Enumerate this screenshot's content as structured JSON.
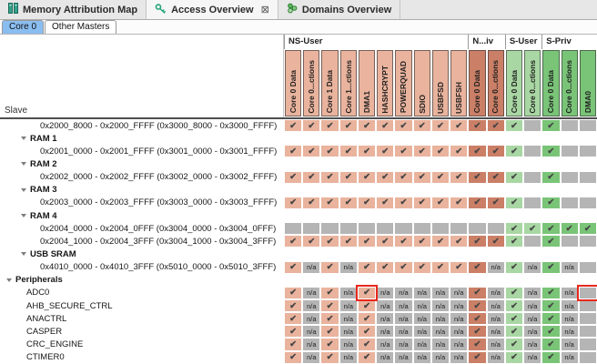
{
  "colors": {
    "ns": "#e9b39d",
    "nspriv": "#ca7f66",
    "suser": "#a9d7a3",
    "spriv": "#7ac478",
    "empty": "#b5b5b5",
    "highlight": "#e8281e",
    "subtab_selected": "#8abdf0",
    "check": "#454545"
  },
  "view_tabs": [
    {
      "label": "Memory Attribution Map",
      "icon": "memory-map-icon",
      "active": false
    },
    {
      "label": "Access Overview",
      "icon": "key-icon",
      "active": true,
      "close_glyph": "⊠"
    },
    {
      "label": "Domains Overview",
      "icon": "domains-icon",
      "active": false
    }
  ],
  "sub_tabs": [
    {
      "label": "Core 0",
      "active": true
    },
    {
      "label": "Other Masters",
      "active": false
    }
  ],
  "table": {
    "slave_header": "Slave",
    "check_glyph": "✔",
    "na_label": "n/a",
    "groups": [
      {
        "label": "NS-User",
        "span": 10
      },
      {
        "label": "N...iv",
        "span": 2
      },
      {
        "label": "S-User",
        "span": 2
      },
      {
        "label": "S-Priv",
        "span": 3
      }
    ],
    "columns": [
      {
        "label": "Core 0 Data",
        "color": "ns"
      },
      {
        "label": "Core 0...ctions",
        "color": "ns"
      },
      {
        "label": "Core 1 Data",
        "color": "ns"
      },
      {
        "label": "Core 1...ctions",
        "color": "ns"
      },
      {
        "label": "DMA1",
        "color": "ns"
      },
      {
        "label": "HASHCRYPT",
        "color": "ns"
      },
      {
        "label": "POWERQUAD",
        "color": "ns"
      },
      {
        "label": "SDIO",
        "color": "ns"
      },
      {
        "label": "USBFSD",
        "color": "ns"
      },
      {
        "label": "USBFSH",
        "color": "ns"
      },
      {
        "label": "Core 0 Data",
        "color": "nspriv"
      },
      {
        "label": "Core 0...ctions",
        "color": "nspriv"
      },
      {
        "label": "Core 0 Data",
        "color": "suser"
      },
      {
        "label": "Core 0...ctions",
        "color": "suser"
      },
      {
        "label": "Core 0 Data",
        "color": "spriv"
      },
      {
        "label": "Core 0...ctions",
        "color": "spriv"
      },
      {
        "label": "DMA0",
        "color": "spriv"
      }
    ],
    "rows": [
      {
        "type": "addr",
        "label": "0x2000_8000 - 0x2000_FFFF (0x3000_8000 - 0x3000_FFFF)",
        "cells": [
          "ck",
          "ck",
          "ck",
          "ck",
          "ck",
          "ck",
          "ck",
          "ck",
          "ck",
          "ck",
          "ck",
          "ck",
          "ck",
          "",
          "ck",
          "",
          ""
        ]
      },
      {
        "type": "group",
        "indent": 1,
        "label": "RAM 1"
      },
      {
        "type": "addr",
        "label": "0x2001_0000 - 0x2001_FFFF (0x3001_0000 - 0x3001_FFFF)",
        "cells": [
          "ck",
          "ck",
          "ck",
          "ck",
          "ck",
          "ck",
          "ck",
          "ck",
          "ck",
          "ck",
          "ck",
          "ck",
          "ck",
          "",
          "ck",
          "",
          ""
        ]
      },
      {
        "type": "group",
        "indent": 1,
        "label": "RAM 2"
      },
      {
        "type": "addr",
        "label": "0x2002_0000 - 0x2002_FFFF (0x3002_0000 - 0x3002_FFFF)",
        "cells": [
          "ck",
          "ck",
          "ck",
          "ck",
          "ck",
          "ck",
          "ck",
          "ck",
          "ck",
          "ck",
          "ck",
          "ck",
          "ck",
          "",
          "ck",
          "",
          ""
        ]
      },
      {
        "type": "group",
        "indent": 1,
        "label": "RAM 3"
      },
      {
        "type": "addr",
        "label": "0x2003_0000 - 0x2003_FFFF (0x3003_0000 - 0x3003_FFFF)",
        "cells": [
          "ck",
          "ck",
          "ck",
          "ck",
          "ck",
          "ck",
          "ck",
          "ck",
          "ck",
          "ck",
          "ck",
          "ck",
          "ck",
          "",
          "ck",
          "",
          ""
        ]
      },
      {
        "type": "group",
        "indent": 1,
        "label": "RAM 4"
      },
      {
        "type": "addr",
        "label": "0x2004_0000 - 0x2004_0FFF (0x3004_0000 - 0x3004_0FFF)",
        "cells": [
          "",
          "",
          "",
          "",
          "",
          "",
          "",
          "",
          "",
          "",
          "",
          "",
          "ck",
          "ck",
          "ck",
          "ck",
          "ck"
        ]
      },
      {
        "type": "addr",
        "label": "0x2004_1000 - 0x2004_3FFF (0x3004_1000 - 0x3004_3FFF)",
        "cells": [
          "ck",
          "ck",
          "ck",
          "ck",
          "ck",
          "ck",
          "ck",
          "ck",
          "ck",
          "ck",
          "ck",
          "ck",
          "ck",
          "",
          "ck",
          "",
          ""
        ]
      },
      {
        "type": "group",
        "indent": 1,
        "label": "USB SRAM"
      },
      {
        "type": "addr",
        "label": "0x4010_0000 - 0x4010_3FFF (0x5010_0000 - 0x5010_3FFF)",
        "cells": [
          "ck",
          "na",
          "ck",
          "na",
          "ck",
          "ck",
          "ck",
          "ck",
          "ck",
          "ck",
          "ck",
          "na",
          "ck",
          "na",
          "ck",
          "na",
          ""
        ]
      },
      {
        "type": "group",
        "indent": 0,
        "label": "Peripherals"
      },
      {
        "type": "leaf",
        "label": "ADC0",
        "cells": [
          "ck",
          "na",
          "ck",
          "na",
          "ck",
          "na",
          "na",
          "na",
          "na",
          "na",
          "ck",
          "na",
          "ck",
          "na",
          "ck",
          "na",
          ""
        ],
        "highlights": [
          4,
          16
        ]
      },
      {
        "type": "leaf",
        "label": "AHB_SECURE_CTRL",
        "cells": [
          "ck",
          "na",
          "ck",
          "na",
          "ck",
          "na",
          "na",
          "na",
          "na",
          "na",
          "ck",
          "na",
          "ck",
          "na",
          "ck",
          "na",
          ""
        ]
      },
      {
        "type": "leaf",
        "label": "ANACTRL",
        "cells": [
          "ck",
          "na",
          "ck",
          "na",
          "ck",
          "na",
          "na",
          "na",
          "na",
          "na",
          "ck",
          "na",
          "ck",
          "na",
          "ck",
          "na",
          ""
        ]
      },
      {
        "type": "leaf",
        "label": "CASPER",
        "cells": [
          "ck",
          "na",
          "ck",
          "na",
          "ck",
          "na",
          "na",
          "na",
          "na",
          "na",
          "ck",
          "na",
          "ck",
          "na",
          "ck",
          "na",
          ""
        ]
      },
      {
        "type": "leaf",
        "label": "CRC_ENGINE",
        "cells": [
          "ck",
          "na",
          "ck",
          "na",
          "ck",
          "na",
          "na",
          "na",
          "na",
          "na",
          "ck",
          "na",
          "ck",
          "na",
          "ck",
          "na",
          ""
        ]
      },
      {
        "type": "leaf",
        "label": "CTIMER0",
        "cells": [
          "ck",
          "na",
          "ck",
          "na",
          "ck",
          "na",
          "na",
          "na",
          "na",
          "na",
          "ck",
          "na",
          "ck",
          "na",
          "ck",
          "na",
          ""
        ]
      }
    ]
  }
}
